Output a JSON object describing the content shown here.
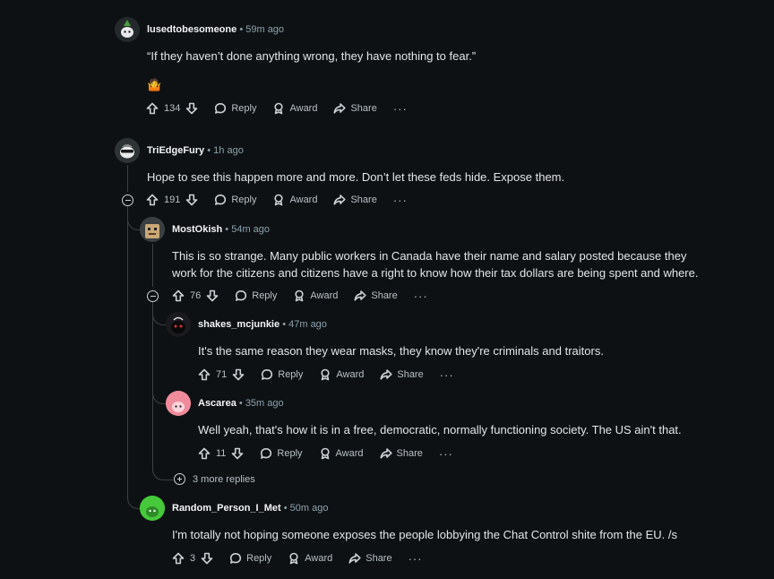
{
  "comments": [
    {
      "username": "lusedtobesomeone",
      "time": "59m ago",
      "body": "“If they haven’t done anything wrong, they have nothing to fear.”",
      "votes": "134",
      "emoji": "🤷"
    },
    {
      "username": "TriEdgeFury",
      "time": "1h ago",
      "body": "Hope to see this happen more and more. Don’t let these feds hide. Expose them.",
      "votes": "191"
    },
    {
      "username": "MostOkish",
      "time": "54m ago",
      "body": "This is so strange. Many public workers in Canada have their name and salary posted because they work for the citizens and citizens have a right to know how their tax dollars are being spent and where.",
      "votes": "76"
    },
    {
      "username": "shakes_mcjunkie",
      "time": "47m ago",
      "body": "It's the same reason they wear masks, they know they're criminals and traitors.",
      "votes": "71"
    },
    {
      "username": "Ascarea",
      "time": "35m ago",
      "body": "Well yeah, that's how it is in a free, democratic, normally functioning society. The US ain't that.",
      "votes": "11"
    },
    {
      "username": "Random_Person_I_Met",
      "time": "50m ago",
      "body": "I'm totally not hoping someone exposes the people lobbying the Chat Control shite from the EU. /s",
      "votes": "3"
    }
  ],
  "labels": {
    "reply": "Reply",
    "award": "Award",
    "share": "Share",
    "more": "···",
    "separator": "•",
    "more_replies": "3 more replies"
  },
  "colors": {
    "background": "#0e1113",
    "text": "#e3e6e8",
    "meta": "#8ba2ad",
    "thread_line": "#3a4145"
  }
}
